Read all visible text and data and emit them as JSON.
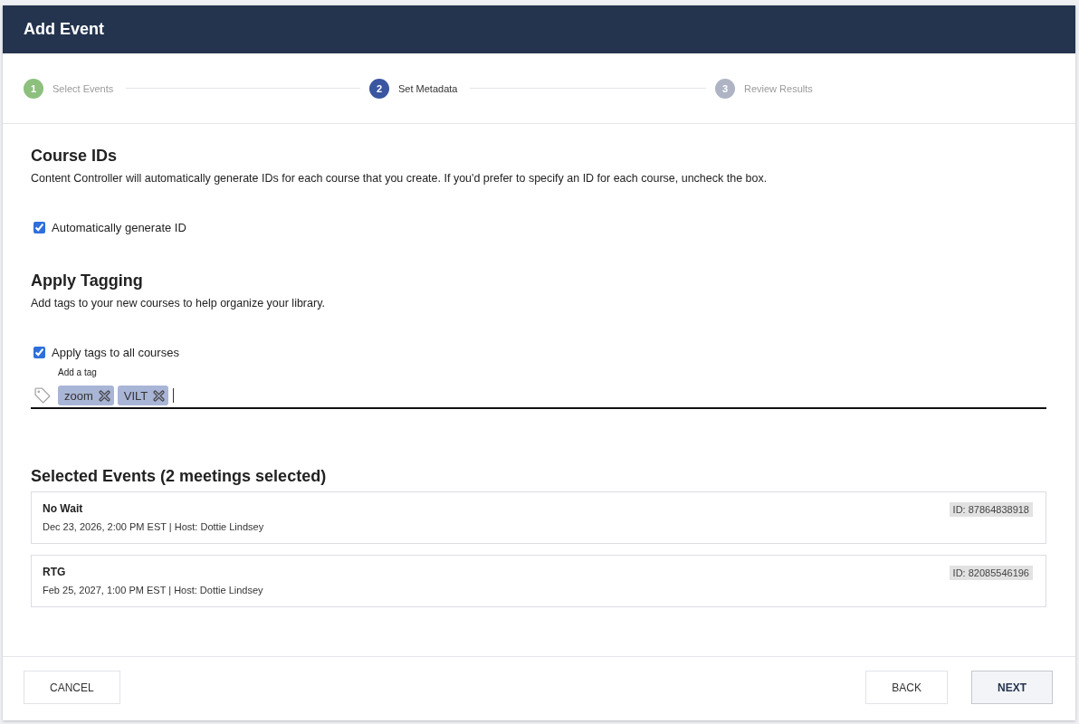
{
  "dialog": {
    "title": "Add Event"
  },
  "steps": [
    {
      "number": "1",
      "label": "Select Events",
      "completed": true,
      "selected": false
    },
    {
      "number": "2",
      "label": "Set Metadata",
      "completed": false,
      "selected": true
    },
    {
      "number": "3",
      "label": "Review Results",
      "completed": false,
      "selected": false
    }
  ],
  "course_ids": {
    "heading": "Course IDs",
    "description": "Content Controller will automatically generate IDs for each course that you create. If you'd prefer to specify an ID for each course, uncheck the box.",
    "checkbox": {
      "label": "Automatically generate ID",
      "checked": true
    }
  },
  "tagging": {
    "heading": "Apply Tagging",
    "description": "Add tags to your new courses to help organize your library.",
    "checkbox": {
      "label": "Apply tags to all courses",
      "checked": true
    },
    "tag_field": {
      "label": "Add a tag",
      "focused": true,
      "tags": [
        "zoom",
        "VILT"
      ]
    }
  },
  "selected_events": {
    "heading": "Selected Events (2 meetings selected)",
    "events": [
      {
        "name": "No Wait",
        "details": "Dec 23, 2026, 2:00 PM EST | Host: Dottie Lindsey",
        "id": "ID: 87864838918"
      },
      {
        "name": "RTG",
        "details": "Feb 25, 2027, 1:00 PM EST | Host: Dottie Lindsey",
        "id": "ID: 82085546196"
      }
    ]
  },
  "footer": {
    "left_buttons": [
      {
        "label": "CANCEL",
        "primary": false
      }
    ],
    "right_buttons": [
      {
        "label": "BACK",
        "primary": false
      },
      {
        "label": "NEXT",
        "primary": true
      }
    ]
  }
}
